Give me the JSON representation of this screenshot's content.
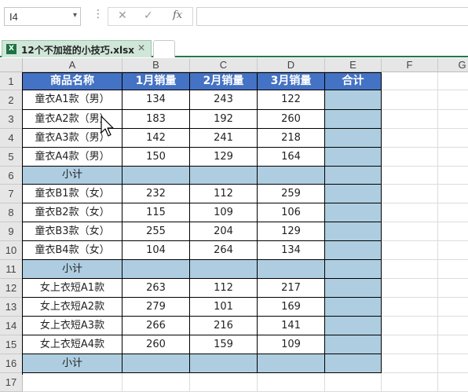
{
  "formula_bar": {
    "name_box": "I4",
    "name_box_arrow": "▾",
    "separator": "⋮",
    "cancel": "✕",
    "enter": "✓",
    "fx": "fx",
    "formula": ""
  },
  "tabs": {
    "active_file": "12个不加班的小技巧.xlsx",
    "excel_icon": "excel-file-icon",
    "close": "✕"
  },
  "columns": [
    "A",
    "B",
    "C",
    "D",
    "E",
    "F",
    "G"
  ],
  "row_numbers": [
    "1",
    "2",
    "3",
    "4",
    "5",
    "6",
    "7",
    "8",
    "9",
    "10",
    "11",
    "12",
    "13",
    "14",
    "15",
    "16",
    "17"
  ],
  "headers": [
    "商品名称",
    "1月销量",
    "2月销量",
    "3月销量",
    "合计"
  ],
  "rows": [
    {
      "name": "童衣A1款（男）",
      "m1": "134",
      "m2": "243",
      "m3": "122",
      "total": "",
      "subtotal": false
    },
    {
      "name": "童衣A2款（男）",
      "m1": "183",
      "m2": "192",
      "m3": "260",
      "total": "",
      "subtotal": false
    },
    {
      "name": "童衣A3款（男）",
      "m1": "142",
      "m2": "241",
      "m3": "218",
      "total": "",
      "subtotal": false
    },
    {
      "name": "童衣A4款（男）",
      "m1": "150",
      "m2": "129",
      "m3": "164",
      "total": "",
      "subtotal": false
    },
    {
      "name": "小计",
      "m1": "",
      "m2": "",
      "m3": "",
      "total": "",
      "subtotal": true
    },
    {
      "name": "童衣B1款（女）",
      "m1": "232",
      "m2": "112",
      "m3": "259",
      "total": "",
      "subtotal": false
    },
    {
      "name": "童衣B2款（女）",
      "m1": "115",
      "m2": "109",
      "m3": "106",
      "total": "",
      "subtotal": false
    },
    {
      "name": "童衣B3款（女）",
      "m1": "255",
      "m2": "204",
      "m3": "129",
      "total": "",
      "subtotal": false
    },
    {
      "name": "童衣B4款（女）",
      "m1": "104",
      "m2": "264",
      "m3": "134",
      "total": "",
      "subtotal": false
    },
    {
      "name": "小计",
      "m1": "",
      "m2": "",
      "m3": "",
      "total": "",
      "subtotal": true
    },
    {
      "name": "女上衣短A1款",
      "m1": "263",
      "m2": "112",
      "m3": "217",
      "total": "",
      "subtotal": false
    },
    {
      "name": "女上衣短A2款",
      "m1": "279",
      "m2": "101",
      "m3": "169",
      "total": "",
      "subtotal": false
    },
    {
      "name": "女上衣短A3款",
      "m1": "266",
      "m2": "216",
      "m3": "141",
      "total": "",
      "subtotal": false
    },
    {
      "name": "女上衣短A4款",
      "m1": "260",
      "m2": "159",
      "m3": "109",
      "total": "",
      "subtotal": false
    },
    {
      "name": "小计",
      "m1": "",
      "m2": "",
      "m3": "",
      "total": "",
      "subtotal": true
    }
  ],
  "colors": {
    "header_fill": "#4472c4",
    "subtotal_fill": "#aecde0",
    "total_column_fill": "#aecde0",
    "tab_accent": "#1e7a4c"
  },
  "cursor_icon": "mouse-pointer-icon"
}
